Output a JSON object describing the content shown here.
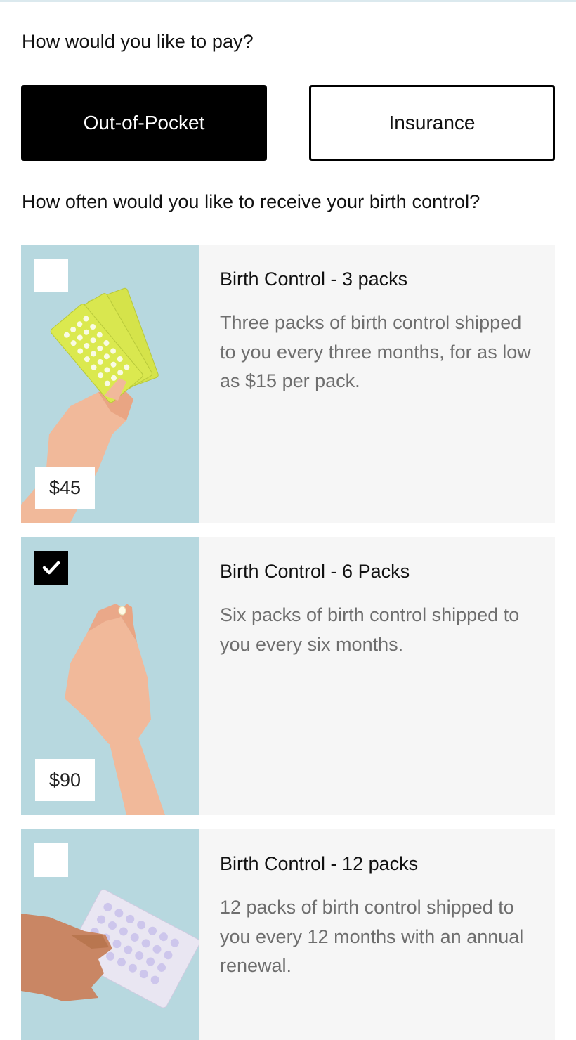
{
  "payment": {
    "question": "How would you like to pay?",
    "options": [
      {
        "label": "Out-of-Pocket",
        "selected": true
      },
      {
        "label": "Insurance",
        "selected": false
      }
    ]
  },
  "frequency": {
    "question": "How often would you like to receive your birth control?"
  },
  "products": [
    {
      "title": "Birth Control - 3 packs",
      "description": "Three packs of birth control shipped to you every three months, for as low as $15 per pack.",
      "price": "$45",
      "checked": false
    },
    {
      "title": "Birth Control - 6 Packs",
      "description": "Six packs of birth control shipped to you every six months.",
      "price": "$90",
      "checked": true
    },
    {
      "title": "Birth Control - 12 packs",
      "description": "12 packs of birth control shipped to you every 12 months with an annual renewal.",
      "price": "",
      "checked": false
    }
  ],
  "colors": {
    "accent": "#000000",
    "image_bg": "#b7d8df",
    "card_bg": "#f6f6f6",
    "description_text": "#6e6e6e"
  }
}
